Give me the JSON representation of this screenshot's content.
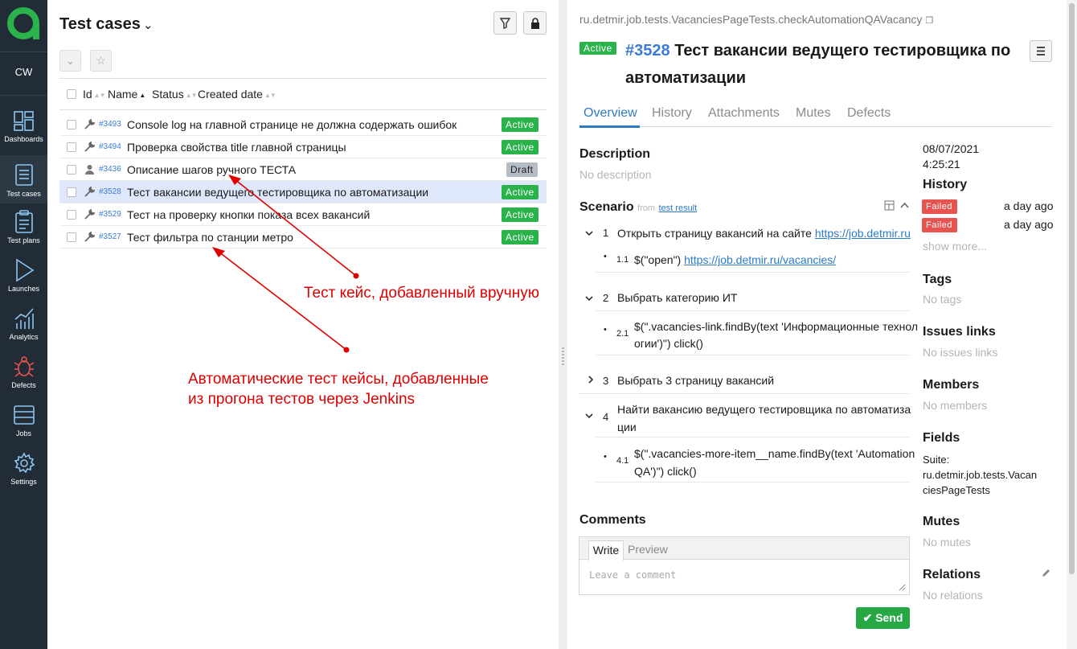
{
  "sidebar": {
    "project": "CW",
    "items": [
      {
        "label": "Dashboards",
        "icon": "dashboards-icon"
      },
      {
        "label": "Test cases",
        "icon": "test-cases-icon"
      },
      {
        "label": "Test plans",
        "icon": "test-plans-icon"
      },
      {
        "label": "Launches",
        "icon": "launches-icon"
      },
      {
        "label": "Analytics",
        "icon": "analytics-icon"
      },
      {
        "label": "Defects",
        "icon": "defects-icon"
      },
      {
        "label": "Jobs",
        "icon": "jobs-icon"
      },
      {
        "label": "Settings",
        "icon": "settings-icon"
      }
    ],
    "active": "Test cases",
    "colors": {
      "background": "#212c36",
      "logo": "#29b34a"
    }
  },
  "list": {
    "title": "Test cases",
    "columns": {
      "id": "Id",
      "name": "Name",
      "status": "Status",
      "created": "Created date"
    },
    "rows": [
      {
        "id": "#3493",
        "name": "Console log на главной странице не должна содержать ошибок",
        "status": "Active",
        "type": "automated"
      },
      {
        "id": "#3494",
        "name": "Проверка свойства title главной страницы",
        "status": "Active",
        "type": "automated"
      },
      {
        "id": "#3436",
        "name": "Описание шагов ручного ТЕСТА",
        "status": "Draft",
        "type": "manual"
      },
      {
        "id": "#3528",
        "name": "Тест вакансии ведущего тестировщика по автоматизации",
        "status": "Active",
        "type": "automated",
        "selected": true
      },
      {
        "id": "#3529",
        "name": "Тест на проверку кнопки показа всех вакансий",
        "status": "Active",
        "type": "automated"
      },
      {
        "id": "#3527",
        "name": "Тест фильтра по станции метро",
        "status": "Active",
        "type": "automated"
      }
    ]
  },
  "annotations": {
    "manual": "Тест кейс, добавленный вручную",
    "auto_line1": "Автоматические тест кейсы, добавленные",
    "auto_line2": "из прогона тестов через Jenkins"
  },
  "detail": {
    "full_name": "ru.detmir.job.tests.VacanciesPageTests.checkAutomationQAVacancy",
    "status": "Active",
    "number": "#3528",
    "title": "Тест вакансии ведущего тестировщика по автоматизации",
    "tabs": [
      "Overview",
      "History",
      "Attachments",
      "Mutes",
      "Defects"
    ],
    "description": {
      "heading": "Description",
      "value": "No description"
    },
    "scenario": {
      "heading": "Scenario",
      "from": "from",
      "from_link": "test result",
      "steps": [
        {
          "n": "1",
          "text": "Открыть страницу вакансий на сайте ",
          "link": "https://job.detmir.ru"
        },
        {
          "n": "1.1",
          "text": "$(\"open\") ",
          "link": "https://job.detmir.ru/vacancies/"
        },
        {
          "n": "2",
          "text": "Выбрать категорию ИТ"
        },
        {
          "n": "2.1",
          "line1": "$(\".vacancies-link.findBy(text 'Информационные технол",
          "line2": "огии')\") click()"
        },
        {
          "n": "3",
          "text": "Выбрать 3 страницу вакансий"
        },
        {
          "n": "4",
          "line1": "Найти вакансию ведущего тестировщика по автоматиза",
          "line2": "ции"
        },
        {
          "n": "4.1",
          "line1": "$(\".vacancies-more-item__name.findBy(text 'Automation",
          "line2": "QA')\") click()"
        }
      ]
    },
    "comments": {
      "heading": "Comments",
      "write": "Write",
      "preview": "Preview",
      "placeholder": "Leave a comment",
      "send": "Send"
    },
    "side": {
      "date": "08/07/2021",
      "time": "4:25:21",
      "history": {
        "heading": "History",
        "entries": [
          {
            "status": "Failed",
            "when": "a day ago"
          },
          {
            "status": "Failed",
            "when": "a day ago"
          }
        ],
        "more": "show more..."
      },
      "tags": {
        "heading": "Tags",
        "value": "No tags"
      },
      "issues": {
        "heading": "Issues links",
        "value": "No issues links"
      },
      "members": {
        "heading": "Members",
        "value": "No members"
      },
      "fields": {
        "heading": "Fields",
        "line1": "Suite:",
        "line2": "ru.detmir.job.tests.Vacan",
        "line3": "ciesPageTests"
      },
      "mutes": {
        "heading": "Mutes",
        "value": "No mutes"
      },
      "relations": {
        "heading": "Relations",
        "value": "No relations"
      }
    }
  }
}
